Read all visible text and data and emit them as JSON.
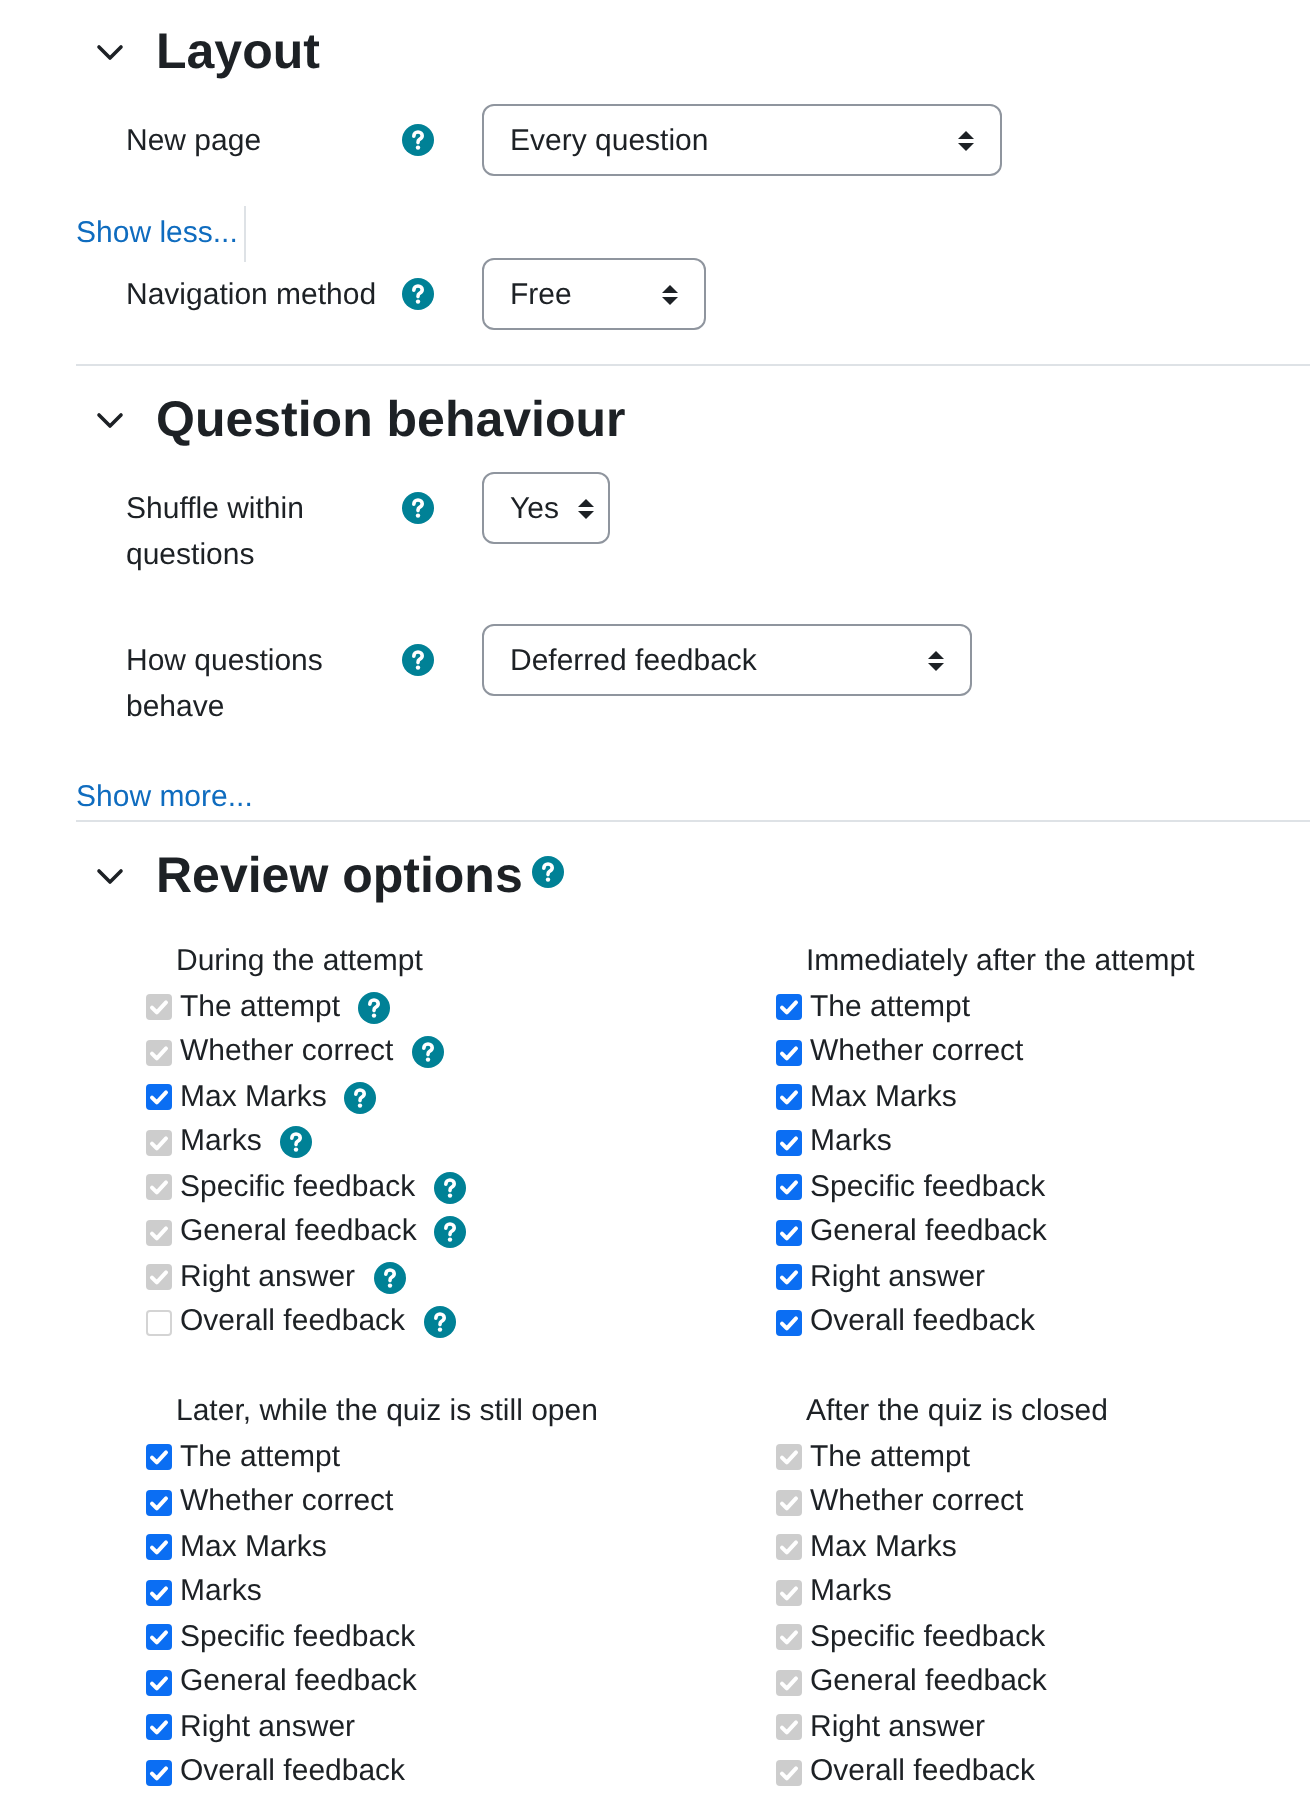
{
  "sections": [
    {
      "title": "Layout",
      "expanded": true,
      "help": false,
      "rows": [
        {
          "kind": "select",
          "label": "New page",
          "help": true,
          "value": "Every question"
        },
        {
          "kind": "link",
          "text": "Show less...",
          "separator": true
        },
        {
          "kind": "select",
          "label": "Navigation method",
          "help": true,
          "value": "Free"
        }
      ]
    },
    {
      "title": "Question behaviour",
      "expanded": true,
      "help": false,
      "rows": [
        {
          "kind": "select",
          "label": "Shuffle within questions",
          "help": true,
          "value": "Yes"
        },
        {
          "kind": "select",
          "label": "How questions behave",
          "help": true,
          "value": "Deferred feedback"
        },
        {
          "kind": "link",
          "text": "Show more...",
          "separator": false
        }
      ]
    },
    {
      "title": "Review options",
      "expanded": true,
      "help": true,
      "groups": [
        {
          "title": "During the attempt",
          "items": [
            {
              "label": "The attempt",
              "checked": true,
              "disabled": true,
              "help": true
            },
            {
              "label": "Whether correct",
              "checked": true,
              "disabled": true,
              "help": true
            },
            {
              "label": "Max Marks",
              "checked": true,
              "disabled": false,
              "help": true
            },
            {
              "label": "Marks",
              "checked": true,
              "disabled": true,
              "help": true
            },
            {
              "label": "Specific feedback",
              "checked": true,
              "disabled": true,
              "help": true
            },
            {
              "label": "General feedback",
              "checked": true,
              "disabled": true,
              "help": true
            },
            {
              "label": "Right answer",
              "checked": true,
              "disabled": true,
              "help": true
            },
            {
              "label": "Overall feedback",
              "checked": false,
              "disabled": true,
              "help": true
            }
          ]
        },
        {
          "title": "Immediately after the attempt",
          "items": [
            {
              "label": "The attempt",
              "checked": true,
              "disabled": false,
              "help": false
            },
            {
              "label": "Whether correct",
              "checked": true,
              "disabled": false,
              "help": false
            },
            {
              "label": "Max Marks",
              "checked": true,
              "disabled": false,
              "help": false
            },
            {
              "label": "Marks",
              "checked": true,
              "disabled": false,
              "help": false
            },
            {
              "label": "Specific feedback",
              "checked": true,
              "disabled": false,
              "help": false
            },
            {
              "label": "General feedback",
              "checked": true,
              "disabled": false,
              "help": false
            },
            {
              "label": "Right answer",
              "checked": true,
              "disabled": false,
              "help": false
            },
            {
              "label": "Overall feedback",
              "checked": true,
              "disabled": false,
              "help": false
            }
          ]
        },
        {
          "title": "Later, while the quiz is still open",
          "items": [
            {
              "label": "The attempt",
              "checked": true,
              "disabled": false,
              "help": false
            },
            {
              "label": "Whether correct",
              "checked": true,
              "disabled": false,
              "help": false
            },
            {
              "label": "Max Marks",
              "checked": true,
              "disabled": false,
              "help": false
            },
            {
              "label": "Marks",
              "checked": true,
              "disabled": false,
              "help": false
            },
            {
              "label": "Specific feedback",
              "checked": true,
              "disabled": false,
              "help": false
            },
            {
              "label": "General feedback",
              "checked": true,
              "disabled": false,
              "help": false
            },
            {
              "label": "Right answer",
              "checked": true,
              "disabled": false,
              "help": false
            },
            {
              "label": "Overall feedback",
              "checked": true,
              "disabled": false,
              "help": false
            }
          ]
        },
        {
          "title": "After the quiz is closed",
          "items": [
            {
              "label": "The attempt",
              "checked": true,
              "disabled": true,
              "help": false
            },
            {
              "label": "Whether correct",
              "checked": true,
              "disabled": true,
              "help": false
            },
            {
              "label": "Max Marks",
              "checked": true,
              "disabled": true,
              "help": false
            },
            {
              "label": "Marks",
              "checked": true,
              "disabled": true,
              "help": false
            },
            {
              "label": "Specific feedback",
              "checked": true,
              "disabled": true,
              "help": false
            },
            {
              "label": "General feedback",
              "checked": true,
              "disabled": true,
              "help": false
            },
            {
              "label": "Right answer",
              "checked": true,
              "disabled": true,
              "help": false
            },
            {
              "label": "Overall feedback",
              "checked": true,
              "disabled": true,
              "help": false
            }
          ]
        }
      ]
    }
  ]
}
